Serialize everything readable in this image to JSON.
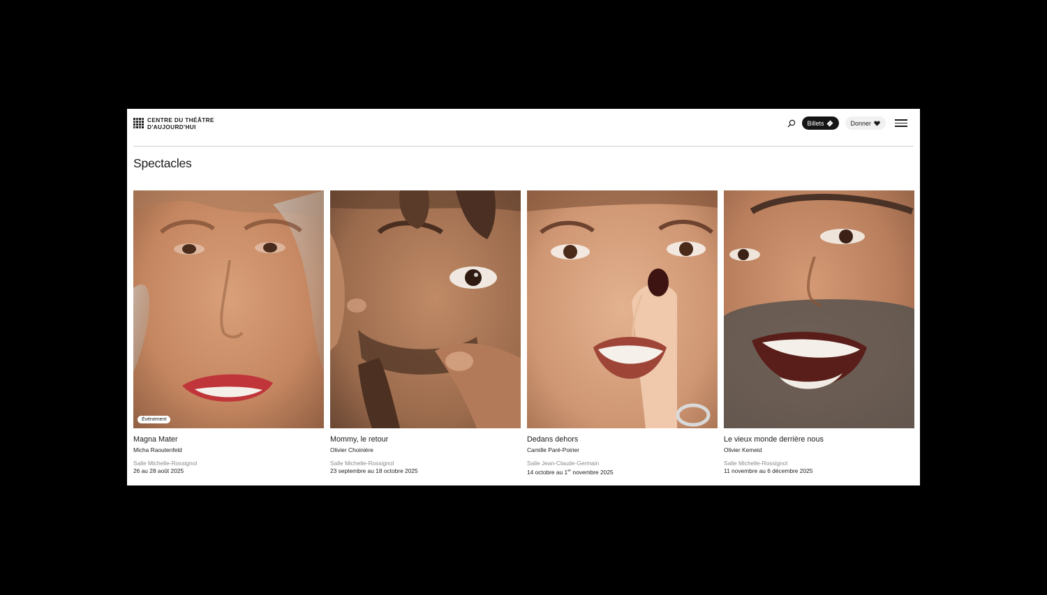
{
  "header": {
    "logo_line1": "CENTRE DU THÉÂTRE",
    "logo_line2": "D'AUJOURD'HUI",
    "search_icon": "search-icon",
    "tickets_label": "Billets",
    "tickets_icon": "ticket-icon",
    "donate_label": "Donner",
    "donate_icon": "heart-icon",
    "menu_icon": "hamburger-icon"
  },
  "page": {
    "title": "Spectacles"
  },
  "shows": [
    {
      "title": "Magna Mater",
      "artist": "Micha Raoutenfeld",
      "venue": "Salle Michelle-Rossignol",
      "dates": "26 au 28 août 2025",
      "badge": "Événement"
    },
    {
      "title": "Mommy, le retour",
      "artist": "Olivier Choinière",
      "venue": "Salle Michelle-Rossignol",
      "dates": "23 septembre au 18 octobre 2025"
    },
    {
      "title": "Dedans dehors",
      "artist": "Camille Paré-Poirier",
      "venue": "Salle Jean-Claude-Germain",
      "dates_before": "14 octobre au 1",
      "dates_sup": "er",
      "dates_after": " novembre 2025"
    },
    {
      "title": "Le vieux monde derrière nous",
      "artist": "Olivier Kemeid",
      "venue": "Salle Michelle-Rossignol",
      "dates": "11 novembre au 6 décembre 2025"
    }
  ],
  "colors": {
    "background": "#000000",
    "page": "#ffffff",
    "pill_dark": "#151515",
    "pill_light": "#f1f1f1",
    "muted_text": "#8a8a8a"
  }
}
